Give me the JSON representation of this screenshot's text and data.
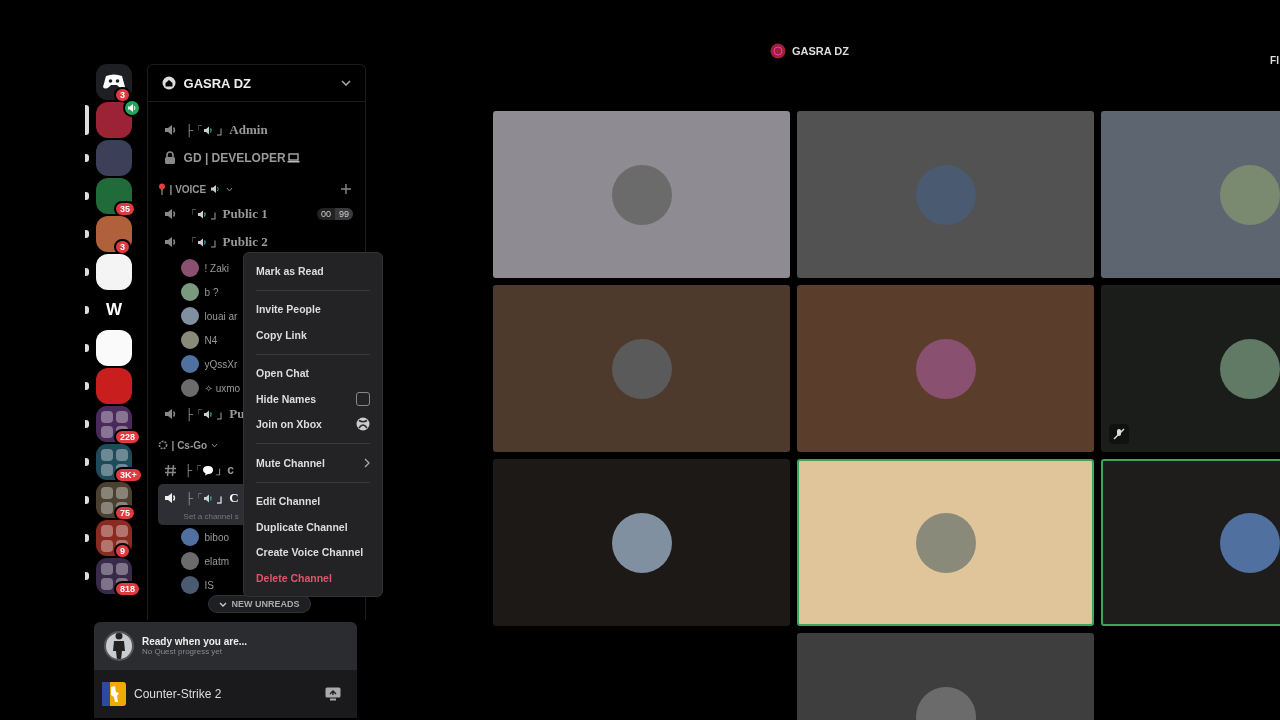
{
  "servers": [
    {
      "kind": "home",
      "selected": false,
      "unread": false,
      "badge": "3",
      "color": "#1e1f22"
    },
    {
      "kind": "image",
      "selected": true,
      "unread": false,
      "voice": true,
      "color": "#9b2335"
    },
    {
      "kind": "image",
      "selected": false,
      "unread": true,
      "color": "#3b3f58"
    },
    {
      "kind": "image",
      "selected": false,
      "unread": true,
      "badge": "35",
      "color": "#1f6b3a"
    },
    {
      "kind": "image",
      "selected": false,
      "unread": true,
      "badge": "3",
      "color": "#b0603a"
    },
    {
      "kind": "image",
      "selected": false,
      "unread": true,
      "color": "#f4f4f4"
    },
    {
      "kind": "letter",
      "selected": false,
      "unread": true,
      "letter": "W",
      "color": "#000000"
    },
    {
      "kind": "image",
      "selected": false,
      "unread": true,
      "color": "#fafafa"
    },
    {
      "kind": "image",
      "selected": false,
      "unread": true,
      "color": "#c81e1e"
    },
    {
      "kind": "folder",
      "selected": false,
      "unread": true,
      "badge": "228",
      "color": "#4a2a5a"
    },
    {
      "kind": "folder",
      "selected": false,
      "unread": true,
      "badge": "3K+",
      "color": "#1f4a5a"
    },
    {
      "kind": "folder",
      "selected": false,
      "unread": true,
      "badge": "75",
      "color": "#4a4030"
    },
    {
      "kind": "folder",
      "selected": false,
      "unread": true,
      "badge": "9",
      "color": "#8a2a20"
    },
    {
      "kind": "folder",
      "selected": false,
      "unread": true,
      "badge": "818",
      "color": "#3a2a4a"
    }
  ],
  "server_header": {
    "name": "GASRA DZ"
  },
  "channels": [
    {
      "kind": "voice",
      "selected": false,
      "prefix": "├「",
      "close": "」",
      "name": "Admin"
    },
    {
      "kind": "locked",
      "selected": false,
      "name": "GD | DEVELOPER"
    },
    {
      "kind": "category",
      "name": "| VOICE"
    },
    {
      "kind": "voice",
      "selected": false,
      "prefix": "「",
      "close": "」",
      "name": "Public 1",
      "counts": [
        "00",
        "99"
      ]
    },
    {
      "kind": "voice",
      "selected": false,
      "prefix": "「",
      "close": "」",
      "name": "Public 2",
      "users": [
        {
          "name": "! Zaki"
        },
        {
          "name": "b ?"
        },
        {
          "name": "louai ar"
        },
        {
          "name": "N4"
        },
        {
          "name": "yQssXr"
        },
        {
          "name": "✧ uxmo"
        }
      ]
    },
    {
      "kind": "voice",
      "selected": false,
      "prefix": "├「",
      "close": "」",
      "name": "Pu"
    },
    {
      "kind": "category",
      "name": "| Cs-Go"
    },
    {
      "kind": "text",
      "selected": false,
      "prefix": "├「",
      "close": "」",
      "name": "c"
    },
    {
      "kind": "voice",
      "selected": true,
      "prefix": "├「",
      "close": "」",
      "name": "C",
      "status": "Set a channel s",
      "users": [
        {
          "name": "biboo"
        },
        {
          "name": "elatm"
        },
        {
          "name": "IS"
        }
      ]
    }
  ],
  "new_unreads": "NEW UNREADS",
  "quest": {
    "title": "Ready when you are...",
    "subtitle": "No Quest progress yet"
  },
  "activity": {
    "game": "Counter-Strike 2"
  },
  "stage_header": {
    "server": "GASRA DZ",
    "right_label": "FI"
  },
  "tiles": [
    {
      "color": "#8e8b92",
      "speaking": false,
      "muted": false
    },
    {
      "color": "#525252",
      "speaking": false,
      "muted": false
    },
    {
      "color": "#5d6570",
      "speaking": false,
      "muted": false
    },
    {
      "color": "#4d3a2c",
      "speaking": false,
      "muted": false
    },
    {
      "color": "#5a3e2b",
      "speaking": false,
      "muted": false
    },
    {
      "color": "#1a1d1a",
      "speaking": false,
      "muted": true
    },
    {
      "color": "#1c1917",
      "speaking": false,
      "muted": false
    },
    {
      "color": "#e1c59a",
      "speaking": true,
      "muted": false
    },
    {
      "color": "#1e1d1b",
      "speaking": true,
      "muted": false
    },
    {
      "color": "#3e3e3e",
      "speaking": false,
      "muted": false
    }
  ],
  "context_menu": {
    "groups": [
      {
        "items": [
          {
            "kind": "item",
            "label": "Mark as Read"
          }
        ]
      },
      {
        "items": [
          {
            "kind": "item",
            "label": "Invite People"
          },
          {
            "kind": "item",
            "label": "Copy Link"
          }
        ]
      },
      {
        "items": [
          {
            "kind": "item",
            "label": "Open Chat"
          },
          {
            "kind": "checkbox",
            "label": "Hide Names",
            "checked": false
          },
          {
            "kind": "xbox",
            "label": "Join on Xbox"
          }
        ]
      },
      {
        "items": [
          {
            "kind": "submenu",
            "label": "Mute Channel"
          }
        ]
      },
      {
        "items": [
          {
            "kind": "item",
            "label": "Edit Channel"
          },
          {
            "kind": "item",
            "label": "Duplicate Channel"
          },
          {
            "kind": "item",
            "label": "Create Voice Channel"
          },
          {
            "kind": "danger",
            "label": "Delete Channel"
          }
        ]
      }
    ]
  }
}
